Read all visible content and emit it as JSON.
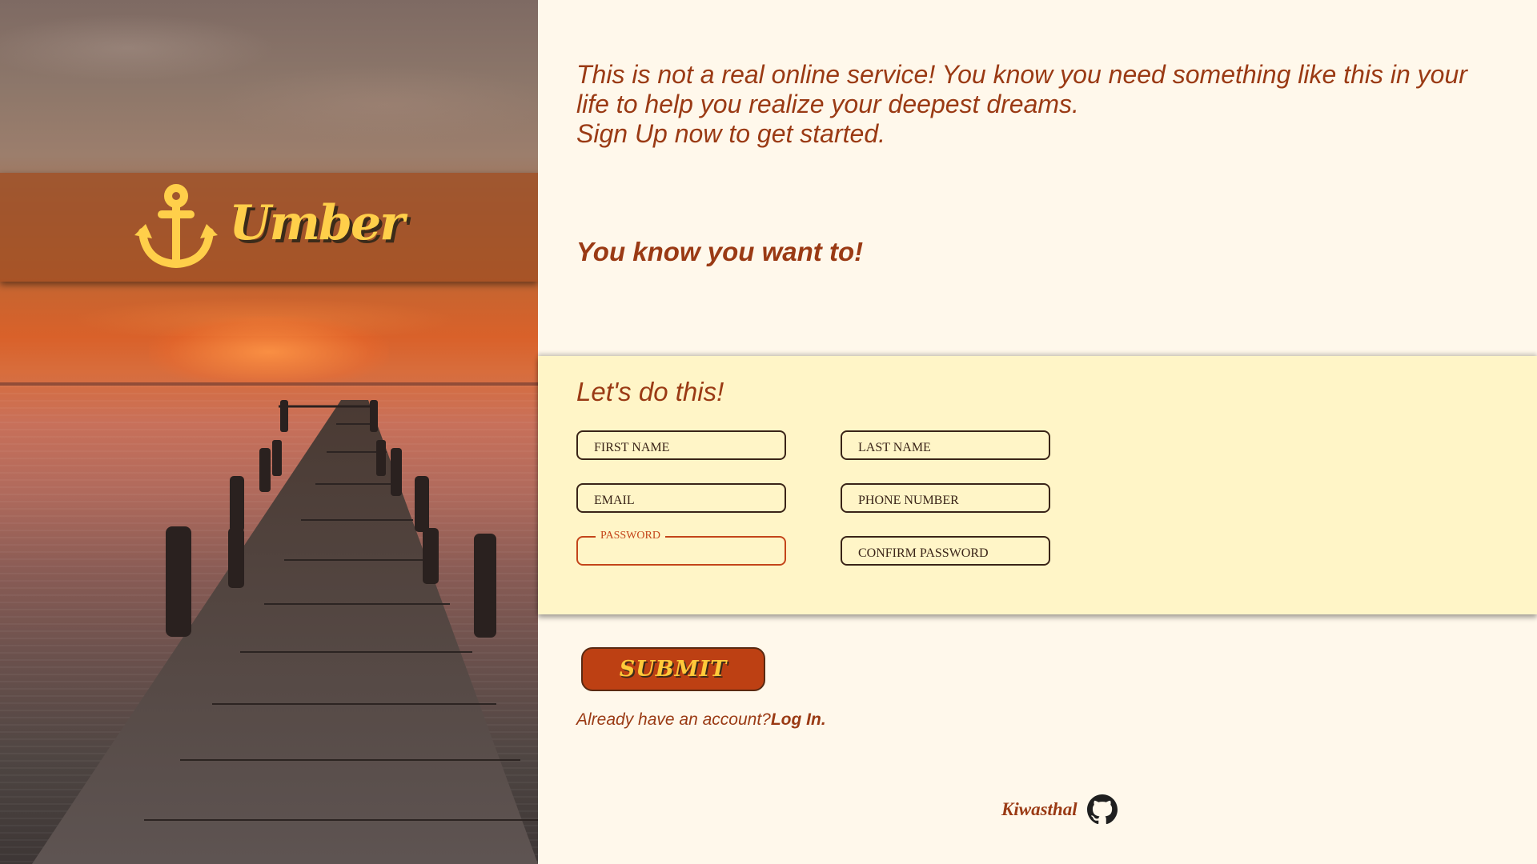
{
  "brand": {
    "name": "Umber",
    "logo_icon": "anchor-icon"
  },
  "intro": {
    "line1": "This is not a real online service! You know you need something like this in your life to help you realize your deepest dreams.",
    "line2": "Sign Up now to get started.",
    "tagline": "You know you want to!"
  },
  "form": {
    "title": "Let's do this!",
    "fields": {
      "first_name": {
        "placeholder": "FIRST NAME",
        "value": ""
      },
      "last_name": {
        "placeholder": "LAST NAME",
        "value": ""
      },
      "email": {
        "placeholder": "EMAIL",
        "value": ""
      },
      "phone": {
        "placeholder": "PHONE NUMBER",
        "value": ""
      },
      "password": {
        "label": "PASSWORD",
        "value": "",
        "focused": true
      },
      "confirm_password": {
        "placeholder": "CONFIRM PASSWORD",
        "value": ""
      }
    },
    "submit_label": "SUBMIT"
  },
  "login": {
    "prompt": "Already have an account?",
    "link_label": "Log In."
  },
  "footer": {
    "author": "Kiwasthal",
    "icon": "github-icon"
  },
  "colors": {
    "accent": "#9a3a14",
    "button": "#bd4013",
    "button_text": "#ffc93a",
    "form_bg": "#fff5c7",
    "page_bg": "#fff8eb",
    "focus": "#c4451a"
  }
}
